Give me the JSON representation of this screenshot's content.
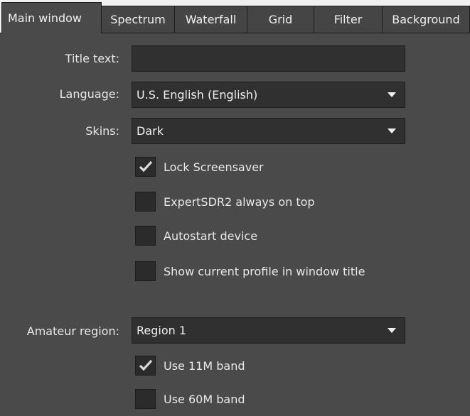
{
  "tabs": [
    {
      "label": "Main window",
      "active": true
    },
    {
      "label": "Spectrum",
      "active": false
    },
    {
      "label": "Waterfall",
      "active": false
    },
    {
      "label": "Grid",
      "active": false
    },
    {
      "label": "Filter",
      "active": false
    },
    {
      "label": "Background",
      "active": false
    }
  ],
  "form": {
    "title_text": {
      "label": "Title text:",
      "value": ""
    },
    "language": {
      "label": "Language:",
      "value": "U.S. English (English)"
    },
    "skins": {
      "label": "Skins:",
      "value": "Dark"
    },
    "checkboxes": [
      {
        "label": "Lock Screensaver",
        "checked": true
      },
      {
        "label": "ExpertSDR2 always on top",
        "checked": false
      },
      {
        "label": "Autostart device",
        "checked": false
      },
      {
        "label": "Show current profile in window title",
        "checked": false
      }
    ],
    "amateur_region": {
      "label": "Amateur region:",
      "value": "Region 1"
    },
    "band_checkboxes": [
      {
        "label": "Use 11M band",
        "checked": true
      },
      {
        "label": "Use 60M band",
        "checked": false
      }
    ]
  },
  "colors": {
    "panel_bg": "#4a4a4a",
    "field_bg": "#303030",
    "text": "#e8e8e8"
  }
}
